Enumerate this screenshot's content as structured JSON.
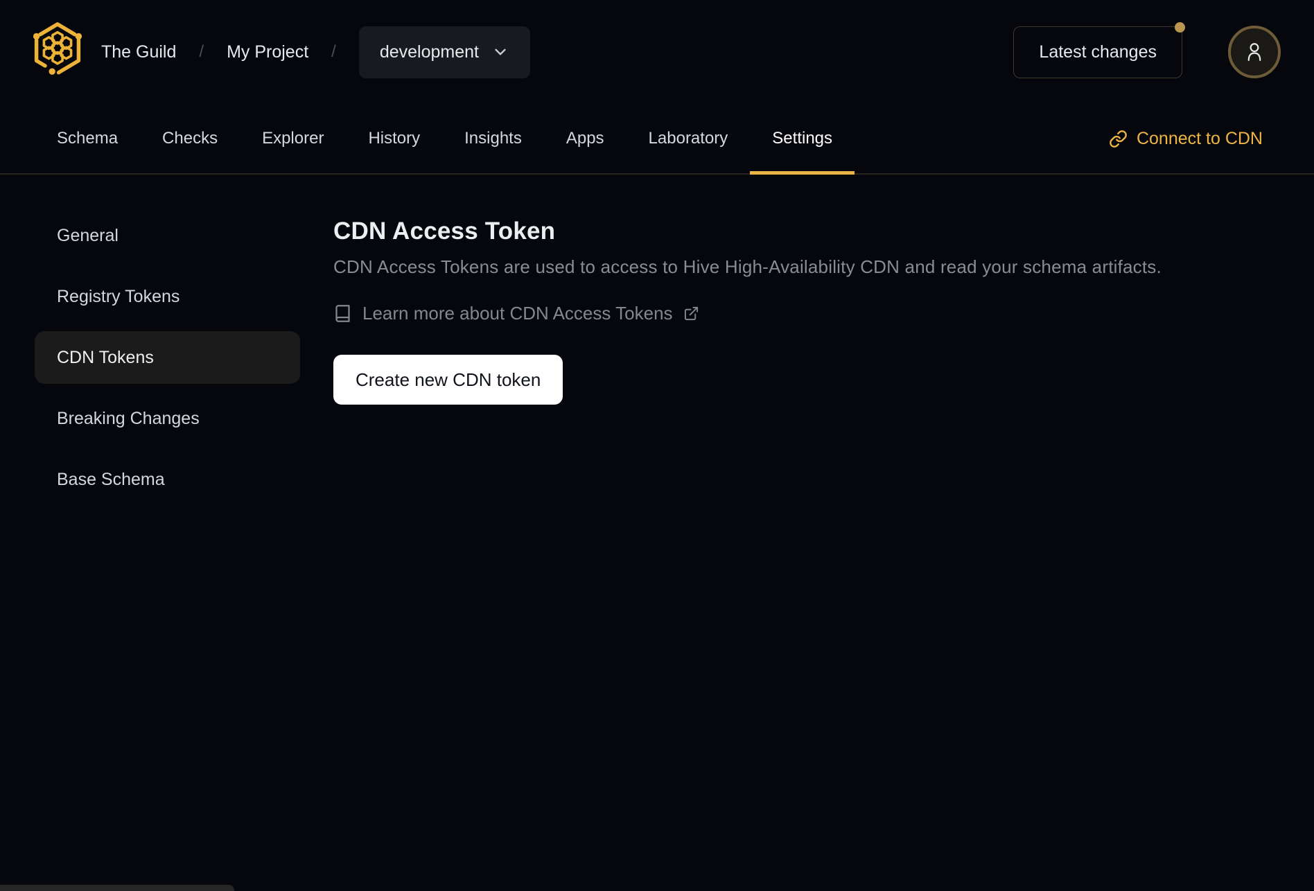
{
  "header": {
    "org": "The Guild",
    "project": "My Project",
    "separator": "/",
    "target_dropdown": {
      "value": "development"
    },
    "latest_changes": {
      "label": "Latest changes",
      "has_notification": true
    }
  },
  "nav": {
    "tabs": [
      {
        "label": "Schema",
        "active": false
      },
      {
        "label": "Checks",
        "active": false
      },
      {
        "label": "Explorer",
        "active": false
      },
      {
        "label": "History",
        "active": false
      },
      {
        "label": "Insights",
        "active": false
      },
      {
        "label": "Apps",
        "active": false
      },
      {
        "label": "Laboratory",
        "active": false
      },
      {
        "label": "Settings",
        "active": true
      }
    ],
    "connect_cdn_label": "Connect to CDN"
  },
  "sidebar": {
    "items": [
      {
        "label": "General",
        "active": false
      },
      {
        "label": "Registry Tokens",
        "active": false
      },
      {
        "label": "CDN Tokens",
        "active": true
      },
      {
        "label": "Breaking Changes",
        "active": false
      },
      {
        "label": "Base Schema",
        "active": false
      }
    ]
  },
  "main": {
    "title": "CDN Access Token",
    "description": "CDN Access Tokens are used to access to Hive High-Availability CDN and read your schema artifacts.",
    "learn_more_label": "Learn more about CDN Access Tokens",
    "create_button_label": "Create new CDN token"
  },
  "icons": {
    "logo": "hive-honeycomb-logo",
    "dropdown": "chevron-down-icon",
    "connect_cdn": "link-icon",
    "learn_more": "book-icon",
    "learn_more_suffix": "external-link-icon",
    "avatar": "user-icon",
    "latest_changes_badge": "notification-dot"
  },
  "colors": {
    "background": "#05070d",
    "accent_gold": "#ecb445",
    "tab_underline": "#ecb445",
    "notification_dot": "#bb9651",
    "avatar_ring": "#6e5c38",
    "create_button_bg": "#ffffff",
    "sidebar_active_bg": "#1b1b1b",
    "muted_text": "#8a8c94"
  }
}
